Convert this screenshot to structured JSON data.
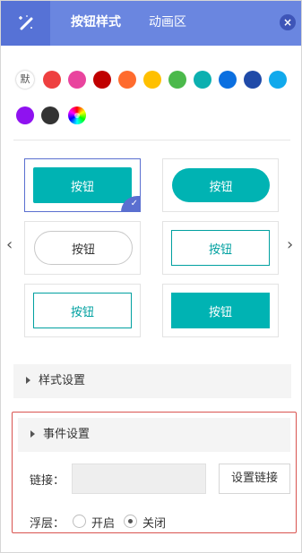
{
  "header": {
    "tool_icon": "magic-wand-icon",
    "tabs": [
      {
        "label": "按钮样式",
        "active": true
      },
      {
        "label": "动画区",
        "active": false
      }
    ],
    "close_glyph": "×"
  },
  "colors": {
    "header_bg": "#6a86e0",
    "accent": "#00b3b3",
    "selected_border": "#5a6fd0",
    "event_border": "#d9534f"
  },
  "swatches": {
    "default_label": "默",
    "palette": [
      "#ee4040",
      "#e9449e",
      "#c00000",
      "#ff6b2e",
      "#ffc000",
      "#4bb94b",
      "#0cb0b0",
      "#0b6fe0",
      "#1f4aa8",
      "#11a9ec",
      "#8f12f0",
      "#333333"
    ]
  },
  "buttons": {
    "items": [
      {
        "label": "按钮",
        "style": "solid-rect"
      },
      {
        "label": "按钮",
        "style": "solid-pill"
      },
      {
        "label": "按钮",
        "style": "outline-pill-gray"
      },
      {
        "label": "按钮",
        "style": "outline-rect"
      },
      {
        "label": "按钮",
        "style": "outline-rect"
      },
      {
        "label": "按钮",
        "style": "solid-rect-flat"
      }
    ],
    "prev": "‹",
    "next": "›"
  },
  "sections": {
    "style_settings": "样式设置",
    "event_settings": "事件设置"
  },
  "event": {
    "link_label": "链接：",
    "link_value": "",
    "link_button": "设置链接",
    "layer_label": "浮层：",
    "option_on": "开启",
    "option_off": "关闭",
    "selected": "关闭"
  }
}
